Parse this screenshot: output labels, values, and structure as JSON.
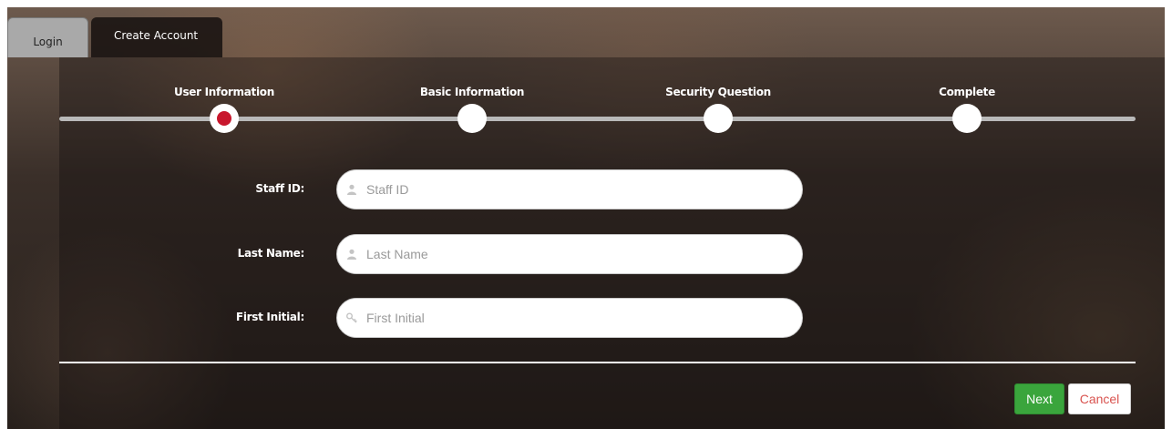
{
  "tabs": [
    {
      "label": "Login",
      "active": false
    },
    {
      "label": "Create Account",
      "active": true
    }
  ],
  "steps": [
    {
      "label": "User Information",
      "active": true
    },
    {
      "label": "Basic Information",
      "active": false
    },
    {
      "label": "Security Question",
      "active": false
    },
    {
      "label": "Complete",
      "active": false
    }
  ],
  "form": {
    "staff_id": {
      "label": "Staff ID:",
      "placeholder": "Staff ID",
      "icon": "user-icon"
    },
    "last_name": {
      "label": "Last Name:",
      "placeholder": "Last Name",
      "icon": "user-icon"
    },
    "first_initial": {
      "label": "First Initial:",
      "placeholder": "First Initial",
      "icon": "key-icon"
    }
  },
  "buttons": {
    "next": "Next",
    "cancel": "Cancel"
  },
  "colors": {
    "active_step_dot": "#c8172d",
    "next_button": "#3aa53c",
    "cancel_text": "#d9534f"
  }
}
